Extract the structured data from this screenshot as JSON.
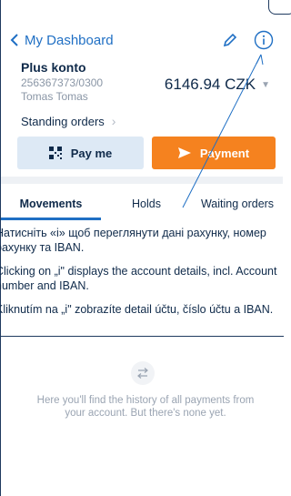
{
  "header": {
    "back_label": "My Dashboard"
  },
  "account": {
    "name": "Plus konto",
    "number": "256367373/0300",
    "holder": "Tomas Tomas",
    "balance": "6146.94 CZK"
  },
  "standing_orders_label": "Standing orders",
  "actions": {
    "pay_me_label": "Pay me",
    "payment_label": "Payment"
  },
  "tabs": [
    "Movements",
    "Holds",
    "Waiting orders"
  ],
  "tooltip": {
    "uk": "Натисніть «і» щоб переглянути дані рахунку, номер рахунку та IBAN.",
    "en": "Clicking on „i\" displays the account details, incl. Account number and IBAN.",
    "cz": "Kliknutím na „i\" zobrazíte detail účtu, číslo účtu a IBAN."
  },
  "empty_state": {
    "text": "Here you'll find the history of all payments from your account. But there's none yet."
  },
  "colors": {
    "accent_blue": "#1f6fc4",
    "navy": "#0f2a4a",
    "orange": "#f5821f",
    "light_blue": "#dde9f5"
  }
}
